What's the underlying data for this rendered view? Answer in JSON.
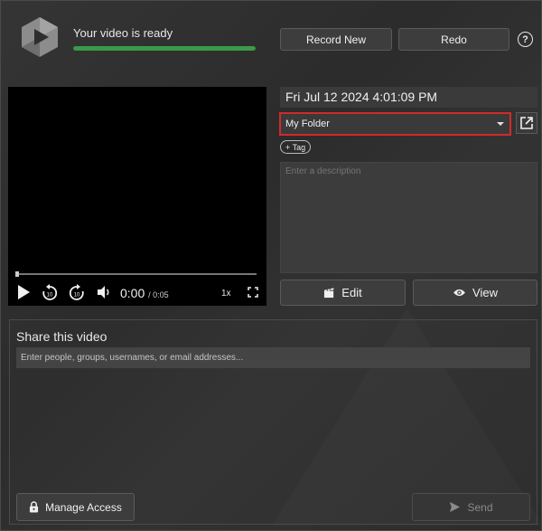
{
  "header": {
    "status_text": "Your video is ready",
    "progress": 1.0,
    "record_new_label": "Record New",
    "redo_label": "Redo",
    "help_icon_glyph": "?"
  },
  "player": {
    "current_time": "0:00",
    "duration": "/ 0:05",
    "speed": "1x",
    "skip_back_seconds": "10",
    "skip_forward_seconds": "10"
  },
  "details": {
    "date": "Fri Jul 12 2024 4:01:09 PM",
    "folder": "My Folder",
    "tag_label": "+ Tag",
    "description_placeholder": "Enter a description",
    "edit_label": "Edit",
    "view_label": "View"
  },
  "share": {
    "title": "Share this video",
    "input_placeholder": "Enter people, groups, usernames, or email addresses...",
    "manage_access_label": "Manage Access",
    "send_label": "Send"
  },
  "colors": {
    "progress": "#3a9a48",
    "highlight": "#d12a2a",
    "background": "#2e2e2e"
  },
  "icons": [
    "logo-icon",
    "help-icon",
    "play-icon",
    "skip-back-icon",
    "skip-forward-icon",
    "volume-icon",
    "fullscreen-icon",
    "dropdown-caret-icon",
    "open-external-icon",
    "edit-icon",
    "eye-icon",
    "lock-icon",
    "send-icon"
  ]
}
